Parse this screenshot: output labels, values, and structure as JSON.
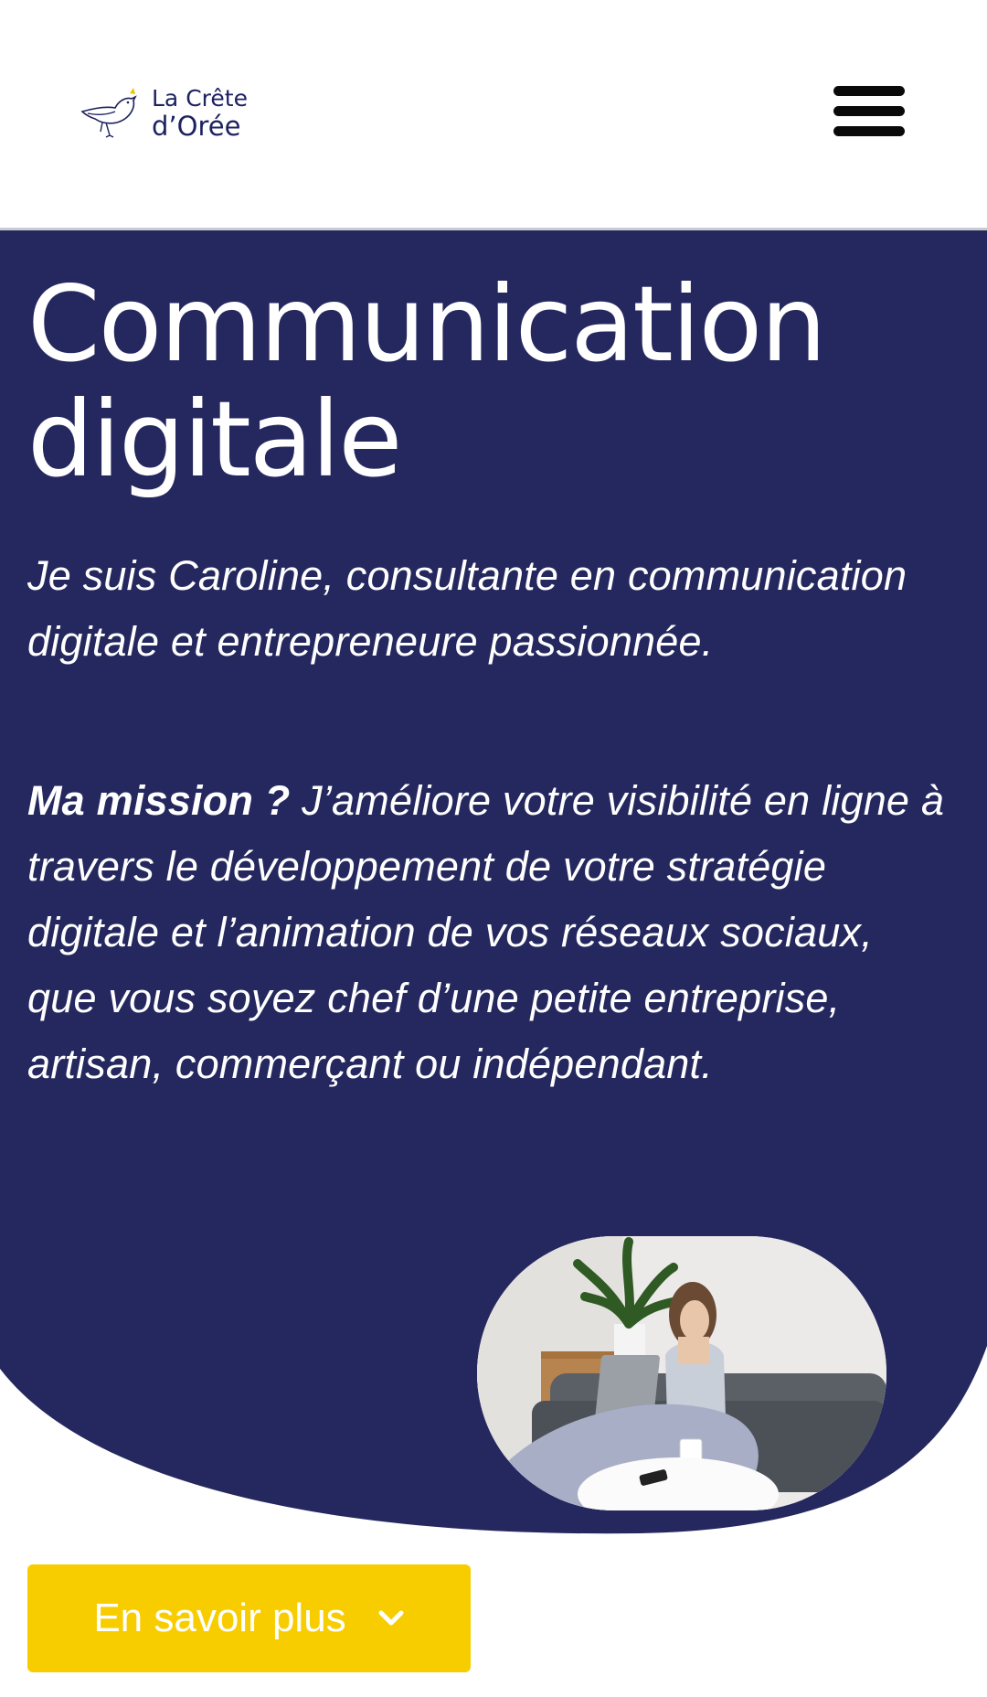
{
  "header": {
    "logo_line1": "La Crête",
    "logo_line2": "d’Orée",
    "menu_icon": "hamburger-menu-icon"
  },
  "hero": {
    "title_line1": "Communication",
    "title_line2": "digitale",
    "intro": "Je suis Caroline, consultante en communication digitale et entrepreneure passionnée.",
    "mission_label": "Ma mission ?",
    "mission_text": " J’améliore votre visibilité en ligne à travers le développement de votre stratégie digitale et l’animation de vos réseaux sociaux, que vous soyez chef d’une petite entreprise, artisan, commerçant ou indépendant."
  },
  "cta": {
    "label": "En savoir plus",
    "icon": "chevron-down-icon"
  },
  "colors": {
    "navy": "#25285e",
    "accent_yellow": "#f8cd00",
    "header_bg": "#ffffff"
  }
}
